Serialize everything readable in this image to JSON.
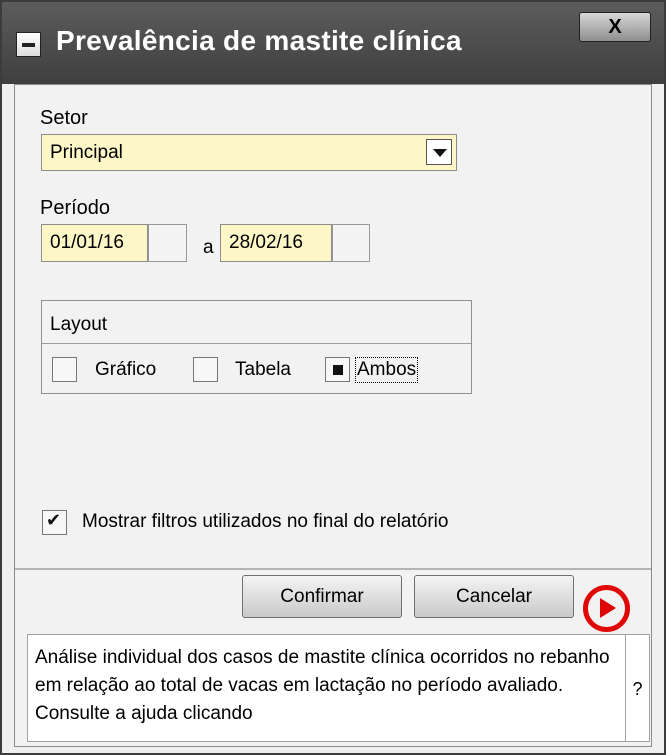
{
  "window": {
    "title": "Prevalência de mastite clínica",
    "close_label": "X"
  },
  "sector": {
    "label": "Setor",
    "value": "Principal"
  },
  "period": {
    "label": "Período",
    "start": "01/01/16",
    "separator": "a",
    "end": "28/02/16"
  },
  "layout": {
    "title": "Layout",
    "options": [
      "Gráfico",
      "Tabela",
      "Ambos"
    ],
    "selected": "Ambos"
  },
  "filters": {
    "label": "Mostrar filtros utilizados no final do relatório",
    "checked": true
  },
  "actions": {
    "confirm": "Confirmar",
    "cancel": "Cancelar"
  },
  "help": {
    "text": "Análise individual dos casos de mastite clínica ocorridos no rebanho em relação ao total de vacas em lactação no período avaliado. Consulte a ajuda clicando",
    "question_mark": "?"
  },
  "icons": {
    "window_menu": "window-menu-icon",
    "close": "close-icon",
    "dropdown": "chevron-down-icon",
    "help": "play-help-icon"
  },
  "colors": {
    "title_bar": "#4a4a4a",
    "input_bg": "#fdf6c7",
    "help_icon": "#e00707"
  }
}
